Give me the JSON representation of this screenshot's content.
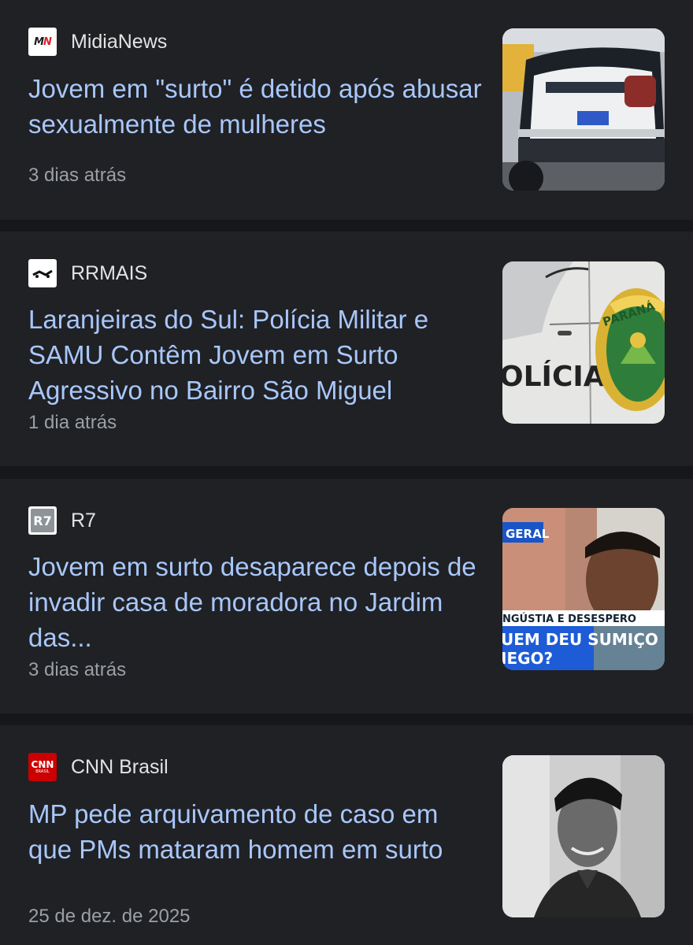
{
  "articles": [
    {
      "source": "MidiaNews",
      "favicon": "midianews-logo",
      "headline": "Jovem em \"surto\" é detido após abusar sexualmente de mulheres",
      "time": "3 dias atrás",
      "thumbnail": "police-car-rear-photo"
    },
    {
      "source": "RRMAIS",
      "favicon": "rrmais-logo",
      "headline": "Laranjeiras do Sul: Polícia Militar e SAMU Contêm Jovem em Surto Agressivo no Bairro São Miguel",
      "time": "1 dia atrás",
      "thumbnail": "police-car-door-photo",
      "thumb_text": {
        "policia": "OLÍCIA",
        "parana": "PARANÁ"
      }
    },
    {
      "source": "R7",
      "favicon": "r7-logo",
      "headline": "Jovem em surto desaparece depois de invadir casa de moradora no Jardim das...",
      "time": "3 dias atrás",
      "thumbnail": "young-man-tv-news-photo",
      "thumb_text": {
        "badge": "GERAL",
        "strap": "NGÚSTIA E DESESPERO",
        "caption_1": "UEM DEU SUMIÇO",
        "caption_2": "IEGO?"
      }
    },
    {
      "source": "CNN Brasil",
      "favicon": "cnn-logo",
      "headline": "MP pede arquivamento de caso em que PMs mataram homem em surto",
      "time": "25 de dez. de 2025",
      "thumbnail": "young-man-bw-portrait-photo"
    }
  ],
  "colors": {
    "background": "#16171b",
    "card": "#202125",
    "headline": "#a8c7fa",
    "source": "#e3e3e3",
    "meta": "#9aa0a6"
  }
}
